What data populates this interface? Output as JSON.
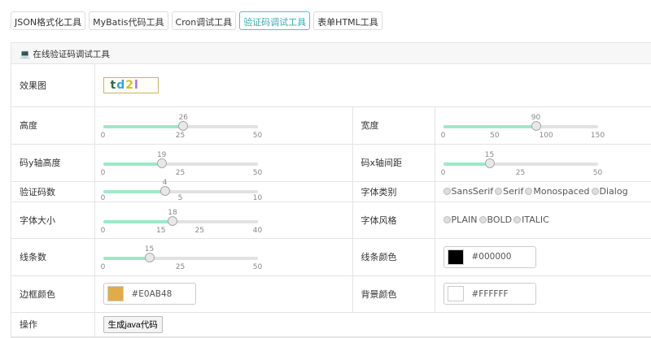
{
  "tabs": [
    "JSON格式化工具",
    "MyBatis代码工具",
    "Cron调试工具",
    "验证码调试工具",
    "表单HTML工具"
  ],
  "active_tab": 3,
  "panel": {
    "title": "在线验证码调试工具",
    "icon": "laptop-icon"
  },
  "captcha": {
    "label": "效果图",
    "text": [
      "t",
      "d",
      "2",
      "l"
    ],
    "colors": [
      "#2d6b4a",
      "#3aa0d0",
      "#d4c030",
      "#b070d0"
    ]
  },
  "sliders": {
    "height": {
      "label": "高度",
      "min": 0,
      "max": 50,
      "value": 26,
      "ticks": [
        0,
        25,
        50
      ]
    },
    "width": {
      "label": "宽度",
      "min": 0,
      "max": 150,
      "value": 90,
      "ticks": [
        0,
        50,
        100,
        150
      ]
    },
    "y_height": {
      "label": "码y轴高度",
      "min": 0,
      "max": 50,
      "value": 19,
      "ticks": [
        0,
        25,
        50
      ]
    },
    "x_spacing": {
      "label": "码x轴间距",
      "min": 0,
      "max": 50,
      "value": 15,
      "ticks": [
        0,
        25,
        50
      ]
    },
    "count": {
      "label": "验证码数",
      "min": 0,
      "max": 10,
      "value": 4,
      "ticks": [
        0,
        5,
        10
      ]
    },
    "font_size": {
      "label": "字体大小",
      "min": 0,
      "max": 40,
      "value": 18,
      "ticks": [
        0,
        15,
        25,
        40
      ]
    },
    "lines": {
      "label": "线条数",
      "min": 0,
      "max": 50,
      "value": 15,
      "ticks": [
        0,
        25,
        50
      ]
    }
  },
  "font_type": {
    "label": "字体类别",
    "options": [
      "SansSerif",
      "Serif",
      "Monospaced",
      "Dialog"
    ]
  },
  "font_style": {
    "label": "字体风格",
    "options": [
      "PLAIN",
      "BOLD",
      "ITALIC"
    ]
  },
  "line_color": {
    "label": "线条颜色",
    "value": "#000000"
  },
  "border_color": {
    "label": "边框颜色",
    "value": "#E0AB48"
  },
  "bg_color": {
    "label": "背景颜色",
    "value": "#FFFFFF"
  },
  "action": {
    "label": "操作",
    "button": "生成java代码"
  }
}
